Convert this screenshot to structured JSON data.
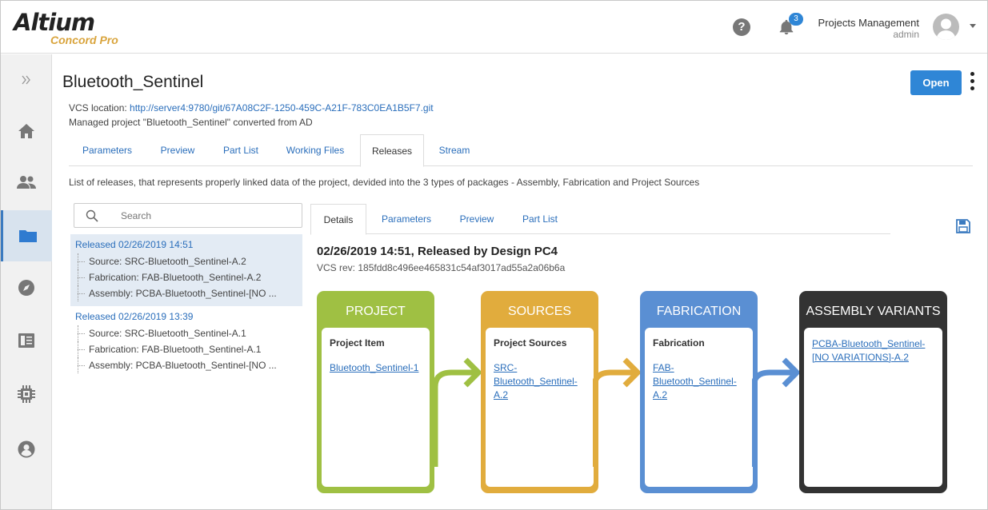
{
  "header": {
    "logo_main": "Altium",
    "logo_sub": "Concord Pro",
    "notification_count": "3",
    "user_title": "Projects Management",
    "user_sub": "admin"
  },
  "sidebar": {
    "items": [
      {
        "icon": "expand-icon"
      },
      {
        "icon": "home-icon"
      },
      {
        "icon": "users-icon"
      },
      {
        "icon": "folder-icon",
        "active": true
      },
      {
        "icon": "compass-icon"
      },
      {
        "icon": "book-icon"
      },
      {
        "icon": "chip-icon"
      },
      {
        "icon": "account-icon"
      }
    ]
  },
  "page": {
    "title": "Bluetooth_Sentinel",
    "open_label": "Open",
    "vcs_label": "VCS location: ",
    "vcs_url": "http://server4:9780/git/67A08C2F-1250-459C-A21F-783C0EA1B5F7.git",
    "managed": "Managed project \"Bluetooth_Sentinel\" converted from AD",
    "description": "List of releases, that represents properly linked data of the project, devided into the 3 types of packages - Assembly, Fabrication and Project Sources"
  },
  "tabs": [
    {
      "label": "Parameters"
    },
    {
      "label": "Preview"
    },
    {
      "label": "Part List"
    },
    {
      "label": "Working Files"
    },
    {
      "label": "Releases",
      "active": true
    },
    {
      "label": "Stream"
    }
  ],
  "search": {
    "placeholder": "Search"
  },
  "releases": [
    {
      "head": "Released 02/26/2019 14:51",
      "selected": true,
      "items": [
        "Source: SRC-Bluetooth_Sentinel-A.2",
        "Fabrication: FAB-Bluetooth_Sentinel-A.2",
        "Assembly: PCBA-Bluetooth_Sentinel-[NO ..."
      ]
    },
    {
      "head": "Released 02/26/2019 13:39",
      "selected": false,
      "items": [
        "Source: SRC-Bluetooth_Sentinel-A.1",
        "Fabrication: FAB-Bluetooth_Sentinel-A.1",
        "Assembly: PCBA-Bluetooth_Sentinel-[NO ..."
      ]
    }
  ],
  "detail_tabs": [
    {
      "label": "Details",
      "active": true
    },
    {
      "label": "Parameters"
    },
    {
      "label": "Preview"
    },
    {
      "label": "Part List"
    }
  ],
  "detail": {
    "title": "02/26/2019 14:51, Released by Design PC4",
    "rev": "VCS rev: 185fdd8c496ee465831c54af3017ad55a2a06b6a"
  },
  "cards": [
    {
      "title": "PROJECT",
      "label": "Project Item",
      "link": "Bluetooth_Sentinel-1",
      "color": "#9fc043"
    },
    {
      "title": "SOURCES",
      "label": "Project Sources",
      "link": "SRC-Bluetooth_Sentinel-A.2",
      "color": "#e1ac3d"
    },
    {
      "title": "FABRICATION",
      "label": "Fabrication",
      "link": "FAB-Bluetooth_Sentinel-A.2",
      "color": "#5a8fd3"
    },
    {
      "title": "ASSEMBLY VARIANTS",
      "label": "",
      "link": "PCBA-Bluetooth_Sentinel-[NO VARIATIONS]-A.2",
      "color": "#333333"
    }
  ],
  "colors": {
    "accent": "#2f86d6",
    "link": "#2a6ebb",
    "project": "#9fc043",
    "sources": "#e1ac3d",
    "fabrication": "#5a8fd3",
    "assembly": "#333333"
  }
}
